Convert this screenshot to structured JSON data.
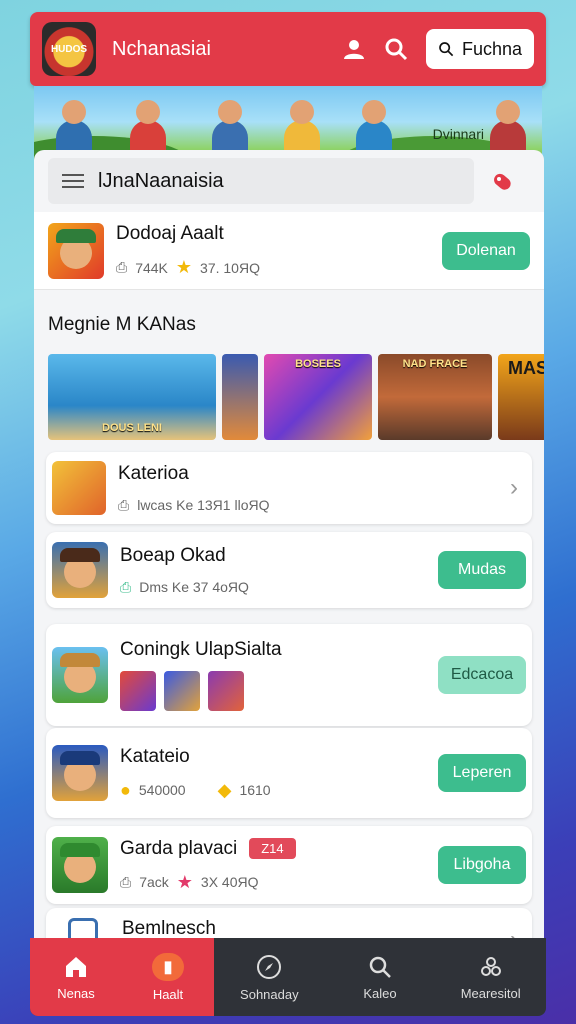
{
  "header": {
    "logo_text": "HUDOS",
    "app_title": "Nchanasiai",
    "search_button_label": "Fuchna"
  },
  "banner": {
    "caption": "Dvinnari"
  },
  "searchbar": {
    "value": "lJnaNaanaisia"
  },
  "featured": {
    "title": "Dodoaj Aaalt",
    "downloads": "744K",
    "rating": "37. 10ЯQ",
    "button": "Dolenan"
  },
  "section": {
    "title": "Megnie M KANas"
  },
  "carousel": [
    {
      "label": "DOUS LENI"
    },
    {
      "label": ""
    },
    {
      "label": "BOSEES"
    },
    {
      "label": "NAD FRACE"
    },
    {
      "label": "MAS"
    }
  ],
  "list": [
    {
      "title": "Katerioa",
      "meta": "lwcas Ke 13Я1 lloЯQ",
      "action": "chevron"
    },
    {
      "title": "Boeap Okad",
      "meta": "Dms Ke  37 4oЯQ",
      "action": "Mudas"
    },
    {
      "title": "Coningk UlapSialta",
      "meta": "",
      "action": "Edcacoa"
    },
    {
      "title": "Katateio",
      "meta_a": "540000",
      "meta_b": "1610",
      "action": "Leperen"
    },
    {
      "title": "Garda plavaci",
      "badge": "Z14",
      "meta_a": "7ack",
      "meta_b": "3X 40ЯQ",
      "action": "Libgoha"
    },
    {
      "title": "Bemlnesch",
      "action": "chevron"
    }
  ],
  "nav": [
    {
      "label": "Nenas",
      "icon": "home-icon",
      "active": true
    },
    {
      "label": "Haalt",
      "icon": "app-icon",
      "active": true
    },
    {
      "label": "Sohnaday",
      "icon": "compass-icon",
      "active": false
    },
    {
      "label": "Kaleo",
      "icon": "search-icon",
      "active": false
    },
    {
      "label": "Mearesitol",
      "icon": "puzzle-icon",
      "active": false
    }
  ],
  "colors": {
    "accent": "#e23a48",
    "button_green": "#3dbd8e",
    "nav_dark": "#2f3238"
  }
}
